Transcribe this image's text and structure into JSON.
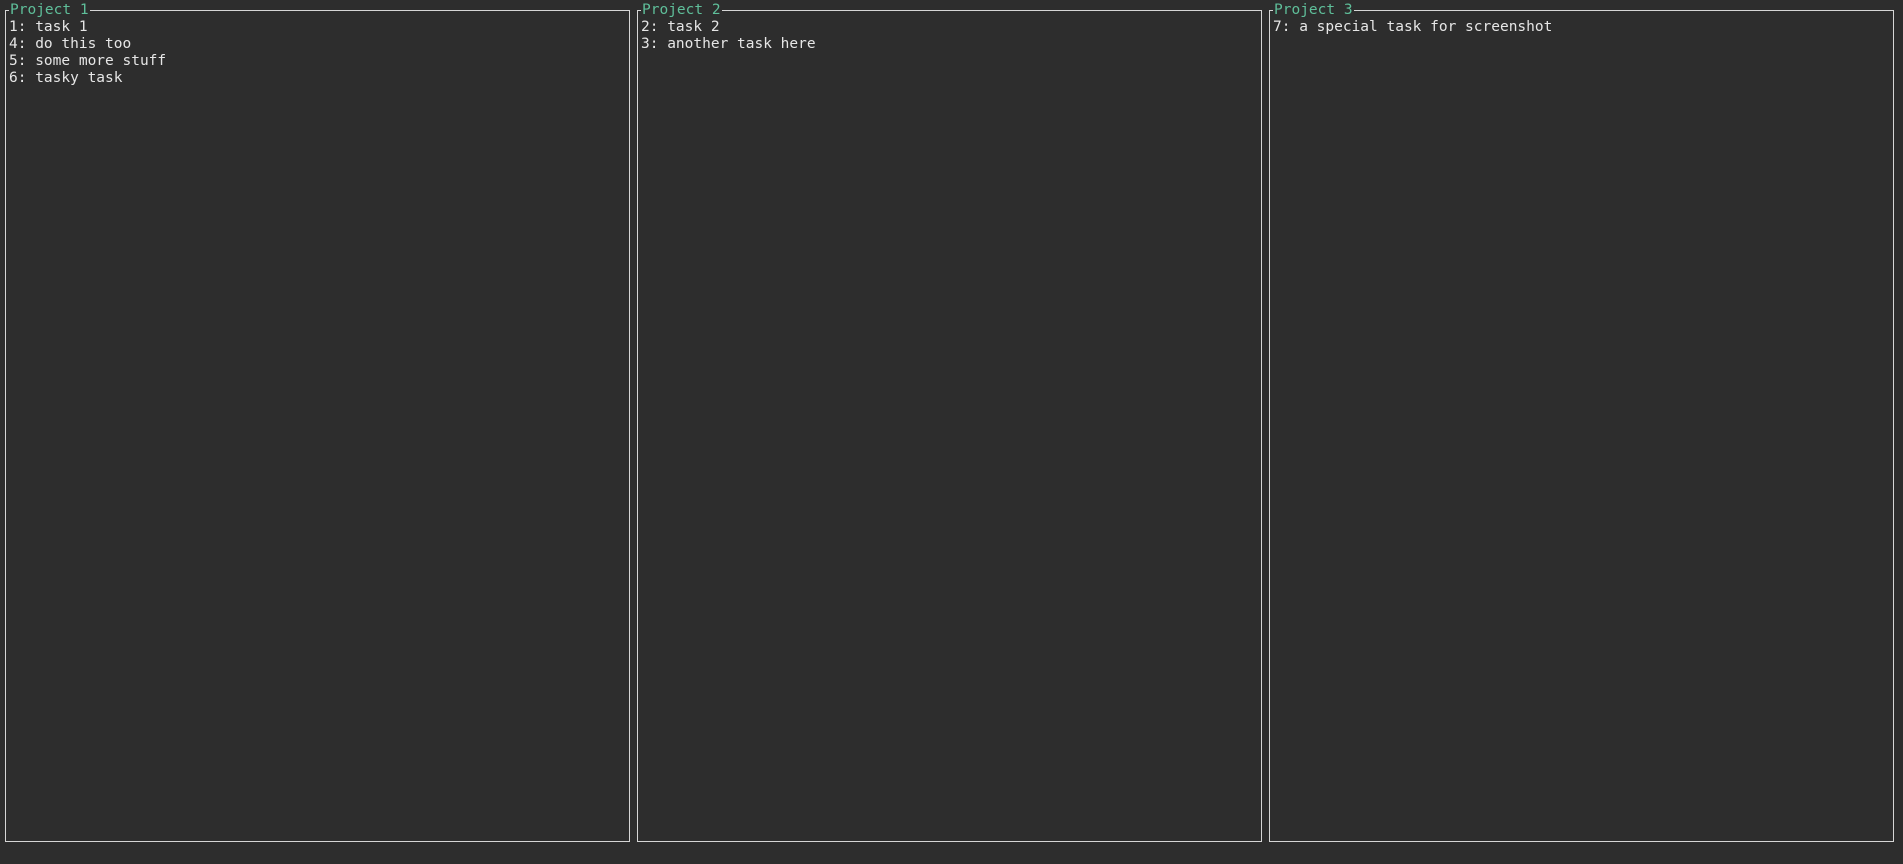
{
  "projects": [
    {
      "title": "Project 1",
      "tasks": [
        {
          "label": "1: task 1"
        },
        {
          "label": "4: do this too"
        },
        {
          "label": "5: some more stuff"
        },
        {
          "label": "6: tasky task"
        }
      ]
    },
    {
      "title": "Project 2",
      "tasks": [
        {
          "label": "2: task 2"
        },
        {
          "label": "3: another task here"
        }
      ]
    },
    {
      "title": "Project 3",
      "tasks": [
        {
          "label": "7: a special task for screenshot"
        }
      ]
    }
  ],
  "colors": {
    "background": "#2d2d2d",
    "border": "#d6d6d6",
    "title": "#5fbf9a",
    "text": "#e6e6e6"
  }
}
